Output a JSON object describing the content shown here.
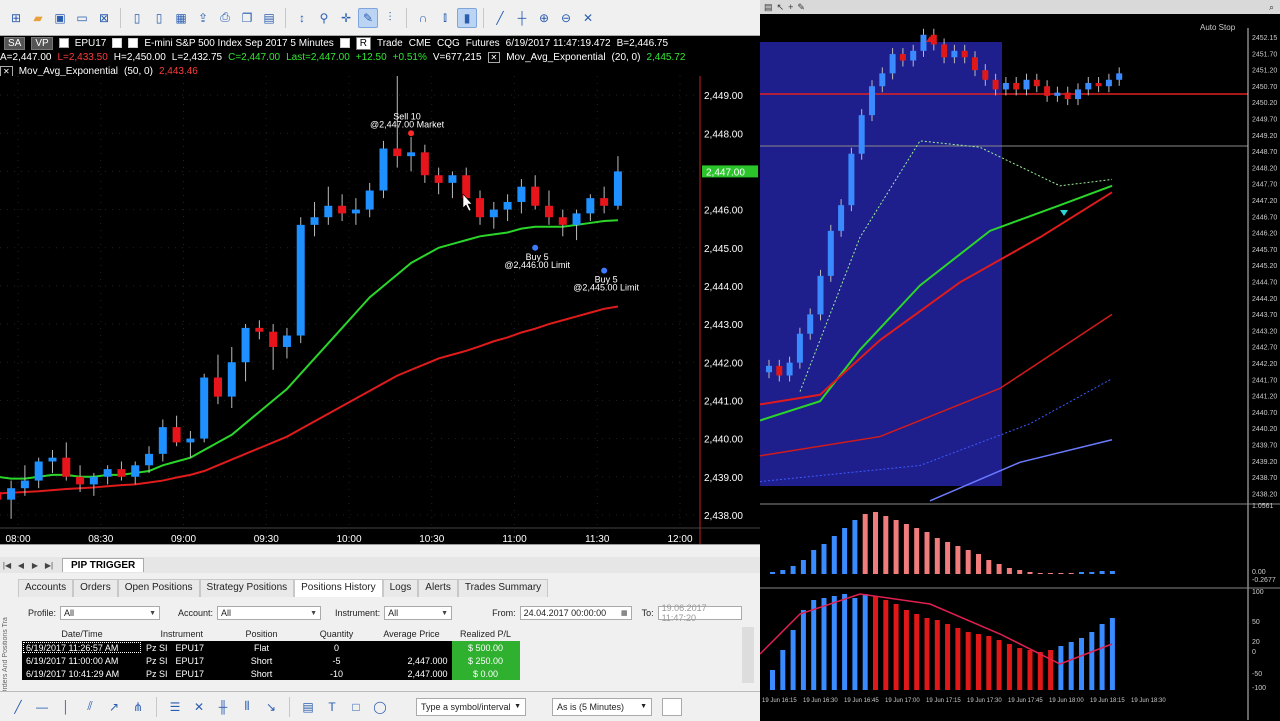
{
  "toolbar": {
    "icons": [
      "new-chart-icon",
      "open-folder-icon",
      "save-icon",
      "layout-icon",
      "close-icon",
      "page-icon",
      "page-icon",
      "grid-icon",
      "export-icon",
      "print-icon",
      "copy-icon",
      "paste-icon",
      "cursor-icon",
      "zoom-icon",
      "crosshair-icon",
      "pencil-icon",
      "chart-type-icon",
      "magnet-icon",
      "bars-icon",
      "candles-icon",
      "line-icon",
      "ohlc-icon",
      "zoom-in-icon",
      "zoom-out-icon",
      "collapse-icon"
    ]
  },
  "header": {
    "sa": "SA",
    "vp": "VP",
    "symbol": "EPU17",
    "instrument_desc": "E-mini S&P 500 Index Sep 2017  5 Minutes",
    "r_badge": "R",
    "trade": "Trade",
    "exchange": "CME",
    "feed": "CQG",
    "type": "Futures",
    "timestamp": "6/19/2017 11:47:19.472",
    "bid": "B=2,446.75",
    "row2_a": "A=2,447.00",
    "row2_l": "L=2,433.50",
    "row2_h": "H=2,450.00",
    "row2_low": "L=2,432.75",
    "row2_c": "C=2,447.00",
    "row2_last": "Last=2,447.00",
    "row2_chg": "+12.50",
    "row2_pct": "+0.51%",
    "row2_v": "V=677,215",
    "ema1_label": "Mov_Avg_Exponential",
    "ema1_params": "(20, 0)",
    "ema1_value": "2,445.72",
    "ema2_label": "Mov_Avg_Exponential",
    "ema2_params": "(50, 0)",
    "ema2_value": "2,443.46"
  },
  "chart_data": {
    "type": "candlestick",
    "y_ticks": [
      "2,449.00",
      "2,448.00",
      "2,447.00",
      "2,446.00",
      "2,445.00",
      "2,444.00",
      "2,443.00",
      "2,442.00",
      "2,441.00",
      "2,440.00",
      "2,439.00",
      "2,438.00"
    ],
    "x_ticks": [
      "08:00",
      "08:30",
      "09:00",
      "09:30",
      "10:00",
      "10:30",
      "11:00",
      "11:30",
      "12:00"
    ],
    "last_price_tag": "2,447.00",
    "ylim": [
      2437.5,
      2449.5
    ],
    "candles": [
      [
        2438.8,
        2439.2,
        2438.5,
        2439.0
      ],
      [
        2439.0,
        2439.5,
        2438.8,
        2439.3
      ],
      [
        2439.3,
        2439.6,
        2438.9,
        2439.1
      ],
      [
        2439.1,
        2439.8,
        2439.0,
        2439.6
      ],
      [
        2439.6,
        2440.3,
        2439.2,
        2439.3
      ],
      [
        2439.3,
        2439.4,
        2438.6,
        2438.8
      ],
      [
        2438.8,
        2439.0,
        2438.4,
        2438.9
      ],
      [
        2438.9,
        2439.2,
        2438.3,
        2438.6
      ],
      [
        2438.6,
        2438.9,
        2438.1,
        2438.4
      ],
      [
        2438.4,
        2438.9,
        2437.9,
        2438.7
      ],
      [
        2438.7,
        2439.3,
        2438.5,
        2438.9
      ],
      [
        2438.9,
        2439.5,
        2438.7,
        2439.4
      ],
      [
        2439.4,
        2439.7,
        2439.1,
        2439.5
      ],
      [
        2439.5,
        2439.9,
        2438.9,
        2439.0
      ],
      [
        2439.0,
        2439.3,
        2438.6,
        2438.8
      ],
      [
        2438.8,
        2439.1,
        2438.5,
        2439.0
      ],
      [
        2439.0,
        2439.3,
        2438.8,
        2439.2
      ],
      [
        2439.2,
        2439.4,
        2438.9,
        2439.0
      ],
      [
        2439.0,
        2439.4,
        2438.8,
        2439.3
      ],
      [
        2439.3,
        2439.8,
        2439.1,
        2439.6
      ],
      [
        2439.6,
        2440.5,
        2439.4,
        2440.3
      ],
      [
        2440.3,
        2440.6,
        2439.8,
        2439.9
      ],
      [
        2439.9,
        2440.2,
        2439.5,
        2440.0
      ],
      [
        2440.0,
        2441.7,
        2439.9,
        2441.6
      ],
      [
        2441.6,
        2442.2,
        2440.9,
        2441.1
      ],
      [
        2441.1,
        2442.4,
        2440.8,
        2442.0
      ],
      [
        2442.0,
        2443.0,
        2441.5,
        2442.9
      ],
      [
        2442.9,
        2443.1,
        2442.6,
        2442.8
      ],
      [
        2442.8,
        2443.0,
        2441.8,
        2442.4
      ],
      [
        2442.4,
        2442.9,
        2442.1,
        2442.7
      ],
      [
        2442.7,
        2445.8,
        2442.5,
        2445.6
      ],
      [
        2445.6,
        2446.2,
        2445.3,
        2445.8
      ],
      [
        2445.8,
        2446.6,
        2445.6,
        2446.1
      ],
      [
        2446.1,
        2446.4,
        2445.7,
        2445.9
      ],
      [
        2445.9,
        2446.3,
        2445.6,
        2446.0
      ],
      [
        2446.0,
        2446.7,
        2445.8,
        2446.5
      ],
      [
        2446.5,
        2447.8,
        2446.3,
        2447.6
      ],
      [
        2447.6,
        2449.8,
        2447.1,
        2447.4
      ],
      [
        2447.4,
        2447.9,
        2447.0,
        2447.5
      ],
      [
        2447.5,
        2447.7,
        2446.7,
        2446.9
      ],
      [
        2446.9,
        2447.1,
        2446.4,
        2446.7
      ],
      [
        2446.7,
        2447.0,
        2446.3,
        2446.9
      ],
      [
        2446.9,
        2447.1,
        2446.2,
        2446.3
      ],
      [
        2446.3,
        2446.5,
        2445.6,
        2445.8
      ],
      [
        2445.8,
        2446.2,
        2445.5,
        2446.0
      ],
      [
        2446.0,
        2446.4,
        2445.7,
        2446.2
      ],
      [
        2446.2,
        2446.8,
        2445.9,
        2446.6
      ],
      [
        2446.6,
        2446.9,
        2446.0,
        2446.1
      ],
      [
        2446.1,
        2446.5,
        2445.6,
        2445.8
      ],
      [
        2445.8,
        2446.0,
        2445.3,
        2445.6
      ],
      [
        2445.6,
        2446.0,
        2445.2,
        2445.9
      ],
      [
        2445.9,
        2446.4,
        2445.7,
        2446.3
      ],
      [
        2446.3,
        2446.6,
        2445.9,
        2446.1
      ],
      [
        2446.1,
        2447.4,
        2446.0,
        2447.0
      ]
    ],
    "ema20": [
      2439.1,
      2439.1,
      2439.15,
      2439.2,
      2439.2,
      2439.15,
      2439.1,
      2439.05,
      2439.0,
      2438.95,
      2438.95,
      2439.0,
      2439.05,
      2439.05,
      2439.0,
      2439.0,
      2439.05,
      2439.05,
      2439.1,
      2439.15,
      2439.3,
      2439.4,
      2439.5,
      2439.7,
      2439.9,
      2440.1,
      2440.4,
      2440.7,
      2441.0,
      2441.3,
      2441.7,
      2442.1,
      2442.5,
      2442.9,
      2443.3,
      2443.7,
      2444.0,
      2444.3,
      2444.6,
      2444.8,
      2445.0,
      2445.1,
      2445.2,
      2445.3,
      2445.35,
      2445.4,
      2445.5,
      2445.55,
      2445.55,
      2445.55,
      2445.6,
      2445.65,
      2445.7,
      2445.72
    ],
    "ema50": [
      2438.4,
      2438.42,
      2438.45,
      2438.47,
      2438.5,
      2438.52,
      2438.53,
      2438.55,
      2438.56,
      2438.58,
      2438.6,
      2438.62,
      2438.65,
      2438.68,
      2438.7,
      2438.72,
      2438.75,
      2438.78,
      2438.8,
      2438.85,
      2438.9,
      2438.98,
      2439.05,
      2439.15,
      2439.3,
      2439.45,
      2439.6,
      2439.75,
      2439.9,
      2440.05,
      2440.25,
      2440.45,
      2440.65,
      2440.85,
      2441.05,
      2441.25,
      2441.45,
      2441.65,
      2441.8,
      2441.95,
      2442.1,
      2442.2,
      2442.3,
      2442.42,
      2442.55,
      2442.65,
      2442.78,
      2442.88,
      2443.0,
      2443.1,
      2443.2,
      2443.3,
      2443.4,
      2443.46
    ],
    "annotations": [
      {
        "text1": "Sell 10",
        "text2": "@2,447.00 Market",
        "candle": 38,
        "price": 2448.0
      },
      {
        "text1": "Buy 5",
        "text2": "@2,446.00 Limit",
        "candle": 47,
        "price": 2445.0
      },
      {
        "text1": "Buy 5",
        "text2": "@2,445.00 Limit",
        "candle": 52,
        "price": 2444.4
      }
    ]
  },
  "right_chart": {
    "label_autostop": "Auto Stop",
    "axis_labels": [
      "2452.15",
      "2451.70",
      "2451.20",
      "2450.70",
      "2450.20",
      "2449.70",
      "2449.20",
      "2448.70",
      "2448.20",
      "2447.70",
      "2447.20",
      "2446.70",
      "2446.20",
      "2445.70",
      "2445.20",
      "2444.70",
      "2444.20",
      "2443.70",
      "2443.20",
      "2442.70",
      "2442.20",
      "2441.70",
      "2441.20",
      "2440.70",
      "2440.20",
      "2439.70",
      "2439.20",
      "2438.70",
      "2438.20"
    ],
    "lower_axis": [
      "1.0561",
      "0.00",
      "-0.2677",
      "100",
      "50",
      "20",
      "0",
      "-50",
      "-100"
    ],
    "dates": [
      "19 Jun 16:15",
      "19 Jun 16:30",
      "19 Jun 16:45",
      "19 Jun 17:00",
      "19 Jun 17:15",
      "19 Jun 17:30",
      "19 Jun 17:45",
      "19 Jun 18:00",
      "19 Jun 18:15",
      "19 Jun 18:30"
    ]
  },
  "bottom": {
    "tab_name": "PIP TRIGGER",
    "tabs": [
      "Accounts",
      "Orders",
      "Open Positions",
      "Strategy Positions",
      "Positions History",
      "Logs",
      "Alerts",
      "Trades Summary"
    ],
    "side_label": "Orders And Positions Tra",
    "filters": {
      "profile_label": "Profile:",
      "profile_value": "All",
      "account_label": "Account:",
      "account_value": "All",
      "instrument_label": "Instrument:",
      "instrument_value": "All",
      "from_label": "From:",
      "from_value": "24.04.2017 00:00:00",
      "to_label": "To:",
      "to_value": "19.06.2017 11:47:20"
    },
    "columns": [
      "Date/Time",
      "Instrument",
      "Position",
      "Quantity",
      "Average Price",
      "Realized P/L"
    ],
    "rows": [
      {
        "date": "6/19/2017 11:26:57 AM",
        "acct": "Pz SI",
        "instr": "EPU17",
        "pos": "Flat",
        "qty": "0",
        "avg": "",
        "pl": "$ 500.00"
      },
      {
        "date": "6/19/2017 11:00:00 AM",
        "acct": "Pz SI",
        "instr": "EPU17",
        "pos": "Short",
        "qty": "-5",
        "avg": "2,447.000",
        "pl": "$ 250.00"
      },
      {
        "date": "6/19/2017 10:41:29 AM",
        "acct": "Pz SI",
        "instr": "EPU17",
        "pos": "Short",
        "qty": "-10",
        "avg": "2,447.000",
        "pl": "$ 0.00"
      }
    ],
    "symbol_combo": "Type a symbol/interval",
    "interval_combo": "As is (5 Minutes)"
  }
}
